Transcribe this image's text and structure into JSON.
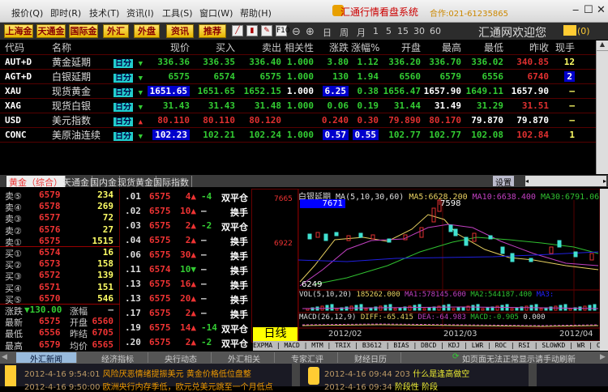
{
  "menu": [
    "报价(Q)",
    "即时(R)",
    "技术(T)",
    "资讯(I)",
    "工具(S)",
    "窗口(W)",
    "帮助(H)"
  ],
  "app_title": "汇通行情看盘系统",
  "app_phone": "合作:021-61235865",
  "toolbar": {
    "buttons": [
      "上海金",
      "天通金",
      "国际金",
      "外汇",
      "外盘",
      "资讯",
      "推荐"
    ],
    "f10": "F10",
    "periods": [
      "日",
      "周",
      "月",
      "1",
      "5",
      "15",
      "30",
      "60"
    ],
    "welcome": "汇通网欢迎您",
    "mail_count": "(0)"
  },
  "quotes": {
    "headers": [
      "代码",
      "名称",
      "",
      "现价",
      "买入",
      "卖出",
      "相关性",
      "涨跌",
      "涨幅%",
      "开盘",
      "最高",
      "最低",
      "昨收",
      "现手"
    ],
    "badge": "日分",
    "rows": [
      {
        "code": "AUT+D",
        "name": "黄金延期",
        "trend": "down",
        "price": "336.36",
        "bid": "336.35",
        "ask": "336.40",
        "corr": "1.000",
        "chg": "3.80",
        "pct": "1.12",
        "open": "336.20",
        "high": "336.70",
        "low": "336.02",
        "prev": "340.85",
        "vol": "12"
      },
      {
        "code": "AGT+D",
        "name": "白银延期",
        "trend": "down",
        "price": "6575",
        "bid": "6574",
        "ask": "6575",
        "corr": "1.000",
        "chg": "130",
        "pct": "1.94",
        "open": "6560",
        "high": "6579",
        "low": "6556",
        "prev": "6740",
        "vol": "2"
      },
      {
        "code": "XAU",
        "name": "现货黄金",
        "trend": "down",
        "price": "1651.65",
        "bid": "1651.65",
        "ask": "1652.15",
        "corr": "1.000",
        "chg": "6.25",
        "pct": "0.38",
        "open": "1656.47",
        "high": "1657.90",
        "low": "1649.11",
        "prev": "1657.90",
        "vol": "—"
      },
      {
        "code": "XAG",
        "name": "现货白银",
        "trend": "down",
        "price": "31.43",
        "bid": "31.43",
        "ask": "31.48",
        "corr": "1.000",
        "chg": "0.06",
        "pct": "0.19",
        "open": "31.44",
        "high": "31.49",
        "low": "31.29",
        "prev": "31.51",
        "vol": "—"
      },
      {
        "code": "USD",
        "name": "美元指数",
        "trend": "up",
        "price": "80.110",
        "bid": "80.110",
        "ask": "80.120",
        "corr": "",
        "chg": "0.240",
        "pct": "0.30",
        "open": "79.890",
        "high": "80.170",
        "low": "79.870",
        "prev": "79.870",
        "vol": "—"
      },
      {
        "code": "CONC",
        "name": "美原油连续",
        "trend": "down",
        "price": "102.23",
        "bid": "102.21",
        "ask": "102.24",
        "corr": "1.000",
        "chg": "0.57",
        "pct": "0.55",
        "open": "102.77",
        "high": "102.77",
        "low": "102.08",
        "prev": "102.84",
        "vol": "1"
      }
    ]
  },
  "mid_tabs": [
    "黄金（综合）",
    "天通金",
    "国内金",
    "现货黄金",
    "国际指数"
  ],
  "settings_label": "设置",
  "book": {
    "sells": [
      {
        "label": "卖⑤",
        "price": "6579",
        "qty": "234"
      },
      {
        "label": "卖④",
        "price": "6578",
        "qty": "269"
      },
      {
        "label": "卖③",
        "price": "6577",
        "qty": "72"
      },
      {
        "label": "卖②",
        "price": "6576",
        "qty": "27"
      },
      {
        "label": "卖①",
        "price": "6575",
        "qty": "1515"
      }
    ],
    "buys": [
      {
        "label": "买①",
        "price": "6574",
        "qty": "16"
      },
      {
        "label": "买②",
        "price": "6573",
        "qty": "158"
      },
      {
        "label": "买③",
        "price": "6572",
        "qty": "139"
      },
      {
        "label": "买④",
        "price": "6571",
        "qty": "151"
      },
      {
        "label": "买⑤",
        "price": "6570",
        "qty": "546"
      }
    ],
    "stats": [
      {
        "l1": "涨跌",
        "v1": "▼130.00",
        "l2": "涨幅",
        "v2": "—"
      },
      {
        "l1": "最新",
        "v1": "6575",
        "l2": "开盘",
        "v2": "6560"
      },
      {
        "l1": "最低",
        "v1": "6556",
        "l2": "昨结",
        "v2": "6705"
      },
      {
        "l1": "最高",
        "v1": "6579",
        "l2": "均价",
        "v2": "6565"
      }
    ]
  },
  "ticks": [
    {
      "t": ".01",
      "p": "6575",
      "q": "4▲",
      "d": "-4",
      "type": "双平仓"
    },
    {
      "t": ".02",
      "p": "6575",
      "q": "10▲",
      "d": "—",
      "type": "换手"
    },
    {
      "t": ".03",
      "p": "6575",
      "q": "2▲",
      "d": "-2",
      "type": "双平仓"
    },
    {
      "t": ".04",
      "p": "6575",
      "q": "2▲",
      "d": "—",
      "type": "换手"
    },
    {
      "t": ".06",
      "p": "6575",
      "q": "30▲",
      "d": "—",
      "type": "换手"
    },
    {
      "t": ".11",
      "p": "6574",
      "q": "10▼",
      "d": "—",
      "type": "换手"
    },
    {
      "t": ".13",
      "p": "6575",
      "q": "16▲",
      "d": "—",
      "type": "换手"
    },
    {
      "t": ".13",
      "p": "6575",
      "q": "20▲",
      "d": "—",
      "type": "换手"
    },
    {
      "t": ".17",
      "p": "6575",
      "q": "2▲",
      "d": "—",
      "type": "换手"
    },
    {
      "t": ".19",
      "p": "6575",
      "q": "14▲",
      "d": "-14",
      "type": "双平仓"
    },
    {
      "t": ".20",
      "p": "6575",
      "q": "2▲",
      "d": "-2",
      "type": "双平仓"
    }
  ],
  "chart": {
    "title": "白银延期",
    "ma_label": "MA(5,10,30,60)",
    "ma5": "MA5:6628.200",
    "ma10": "MA10:6638.400",
    "ma30": "MA30:6791.067",
    "axis_top": "7665",
    "axis_mid": "6922",
    "cursor_price": "7671",
    "high_mark": "7598",
    "low_mark": "6249",
    "vol": "VOL(5,10,20)",
    "vol_val": "185262.000",
    "vol_ma1": "MA1:578145.600",
    "vol_ma2": "MA2:544187.400",
    "vol_ma3": "MA3:",
    "macd": "MACD(26,12,9)",
    "diff": "DIFF:-65.415",
    "dea": "DEA:-64.983",
    "macd_val": "MACD:-0.905",
    "zero": "0.000",
    "dates": [
      "2012/02",
      "2012/03",
      "2012/04"
    ],
    "period_label": "日线",
    "indicators": "EXPMA | MACD | MTM | TRIX | B3612 | BIAS | DBCD | KDJ | LWR | ROC | RSI | SLOWKD | WR | CR | VR | ASI | OBV | WVAD | BO",
    "colors": {
      "ma5": "#e8d060",
      "ma10": "#c040c0",
      "ma30": "#30c030",
      "ma60": "#2020e0",
      "up": "#e03030",
      "down": "#40e0d0"
    }
  },
  "news_tabs": [
    "外汇新闻",
    "经济指标",
    "央行动态",
    "外汇相关",
    "专家汇评",
    "财经日历"
  ],
  "refresh_hint": "如页面无法正常显示请手动刷新",
  "news_left": [
    {
      "time": "2012-4-16 9:54:01",
      "title": "风险厌恶情绪提振美元 黄金价格低位盘整"
    },
    {
      "time": "2012-4-16 9:50:00",
      "title": "欧洲央行内存季低，欧元兑美元跳至一个月低点"
    }
  ],
  "news_right": [
    {
      "time": "2012-4-16 09:44",
      "id": "203",
      "title": "什么是逢高做空"
    },
    {
      "time": "2012-4-16 09:34",
      "id": "",
      "title": "阶段性 阶段"
    }
  ]
}
